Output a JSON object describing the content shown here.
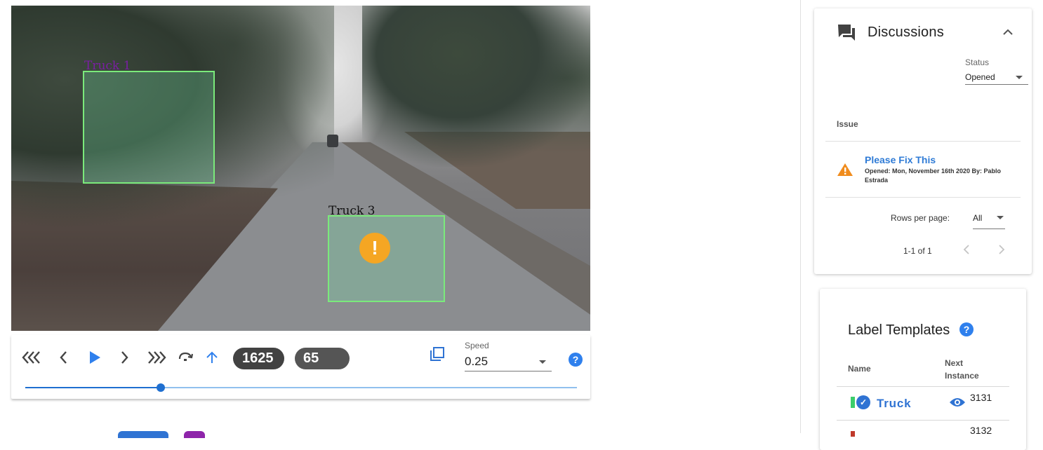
{
  "video": {
    "boxes": [
      {
        "label": "Truck 1",
        "label_color": "#7a1fa2"
      },
      {
        "label": "Truck 3",
        "label_color": "#111111"
      }
    ],
    "warning_marker": "!"
  },
  "player": {
    "icons": [
      "rewind-fast-icon",
      "previous-frame-icon",
      "play-icon",
      "next-frame-icon",
      "forward-fast-icon",
      "loop-icon",
      "up-arrow-icon",
      "copy-icon",
      "help-icon"
    ],
    "frame_number": "1625",
    "instance_number": "65",
    "speed_caption": "Speed",
    "speed_value": "0.25",
    "help": "?",
    "progress": 0.245,
    "accent": "#2f80ed"
  },
  "discussions": {
    "title": "Discussions",
    "status_caption": "Status",
    "status_value": "Opened",
    "column_issue": "Issue",
    "issues": [
      {
        "title": "Please Fix This",
        "meta": "Opened: Mon, November 16th 2020 By: Pablo Estrada"
      }
    ],
    "rows_per_page_label": "Rows per page:",
    "rows_per_page_value": "All",
    "page_info": "1-1 of 1"
  },
  "label_templates": {
    "title": "Label Templates",
    "help": "?",
    "column_name": "Name",
    "column_next": "Next Instance",
    "rows": [
      {
        "name": "Truck",
        "next_instance": "3131",
        "flag_color": "#3ccd6b"
      },
      {
        "name": "",
        "next_instance": "3132",
        "flag_color": "#c0392b"
      }
    ]
  }
}
